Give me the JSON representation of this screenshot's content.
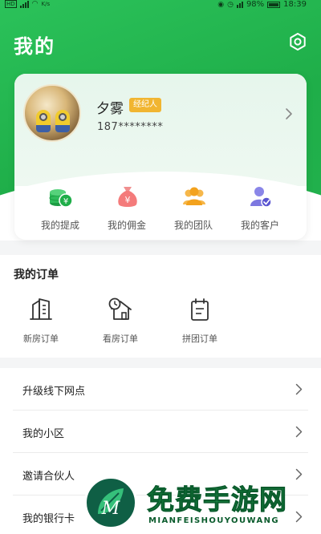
{
  "status_bar": {
    "left_badge": "HD",
    "network_unit": "K/s",
    "battery": "98%",
    "time": "18:39"
  },
  "header": {
    "title": "我的",
    "settings_icon": "gear-icon"
  },
  "profile": {
    "name": "夕雾",
    "role_badge": "经纪人",
    "phone": "187********"
  },
  "stats": [
    {
      "label": "我的提成",
      "icon": "coin-stack-icon"
    },
    {
      "label": "我的佣金",
      "icon": "money-bag-icon"
    },
    {
      "label": "我的团队",
      "icon": "team-icon"
    },
    {
      "label": "我的客户",
      "icon": "customer-icon"
    }
  ],
  "orders": {
    "title": "我的订单",
    "items": [
      {
        "label": "新房订单",
        "icon": "building-icon"
      },
      {
        "label": "看房订单",
        "icon": "house-clock-icon"
      },
      {
        "label": "拼团订单",
        "icon": "calendar-list-icon"
      }
    ]
  },
  "menu": [
    {
      "label": "升级线下网点"
    },
    {
      "label": "我的小区"
    },
    {
      "label": "邀请合伙人"
    },
    {
      "label": "我的银行卡"
    }
  ],
  "watermark": {
    "title": "免费手游网",
    "subtitle": "MIANFEISHOUYOUWANG"
  },
  "colors": {
    "brand_green": "#22b14d",
    "badge_gold": "#f1b531"
  }
}
